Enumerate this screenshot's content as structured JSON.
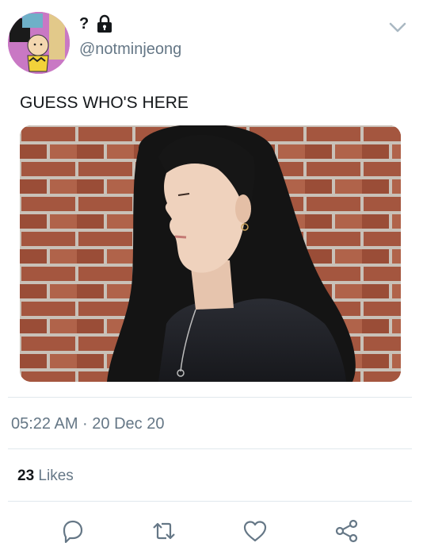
{
  "author": {
    "display_name": "?",
    "handle": "@notminjeong"
  },
  "tweet": {
    "text": "GUESS WHO'S HERE"
  },
  "meta": {
    "timestamp": "05:22 AM · 20 Dec 20",
    "likes_count": "23",
    "likes_label": "Likes"
  },
  "icons": {
    "lock": "lock-icon",
    "menu": "chevron-down-icon",
    "reply": "reply-icon",
    "retweet": "retweet-icon",
    "like": "heart-icon",
    "share": "share-icon"
  },
  "colors": {
    "text": "#14171a",
    "muted": "#657786",
    "icon": "#657786",
    "divider": "#e1e8ed",
    "avatar_bg": "#c978c4"
  }
}
